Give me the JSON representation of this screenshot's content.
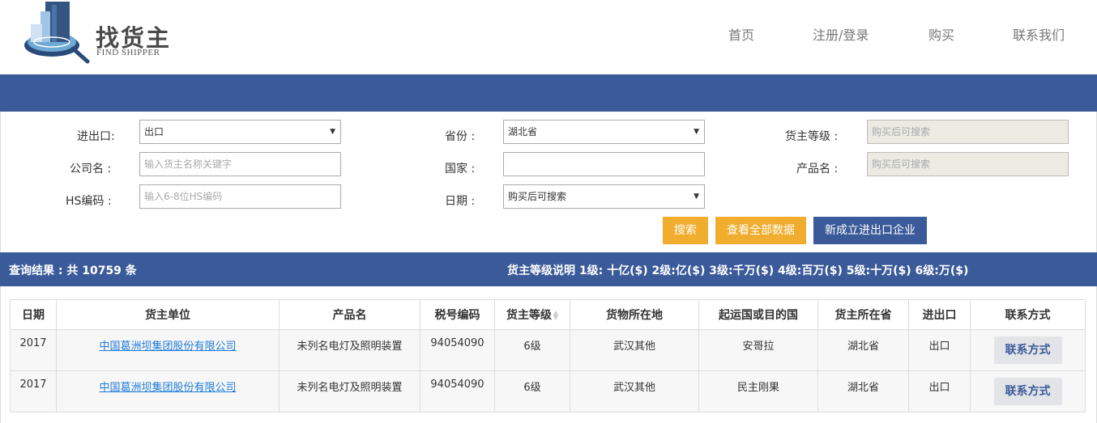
{
  "header": {
    "logo_title": "找货主",
    "logo_sub": "FIND SHIPPER",
    "nav": [
      "首页",
      "注册/登录",
      "购买",
      "联系我们"
    ]
  },
  "form": {
    "row1": {
      "label_a": "进出口:",
      "value_a": "出口",
      "label_b": "省份 :",
      "value_b": "湖北省",
      "label_c": "货主等级 :",
      "placeholder_c": "购买后可搜索"
    },
    "row2": {
      "label_a": "公司名 :",
      "placeholder_a": "输入货主名称关键字",
      "label_b": "国家 :",
      "value_b": "",
      "label_c": "产品名 :",
      "placeholder_c": "购买后可搜索"
    },
    "row3": {
      "label_a": "HS编码 :",
      "placeholder_a": "输入6-8位HS编码",
      "label_b": "日期 :",
      "value_b": "购买后可搜索"
    },
    "buttons": {
      "search": "搜索",
      "view_all": "查看全部数据",
      "new_company": "新成立进出口企业"
    }
  },
  "result": {
    "count_text": "查询结果 : 共 10759 条",
    "grade_legend": "货主等级说明 1级: 十亿($) 2级:亿($) 3级:千万($) 4级:百万($) 5级:十万($) 6级:万($)"
  },
  "table": {
    "headers": [
      "日期",
      "货主单位",
      "产品名",
      "税号编码",
      "货主等级",
      "货物所在地",
      "起运国或目的国",
      "货主所在省",
      "进出口",
      "联系方式"
    ],
    "rows": [
      {
        "date": "2017",
        "company": "中国葛洲坝集团股份有限公司",
        "product": "未列名电灯及照明装置",
        "hs": "94054090",
        "grade": "6级",
        "location": "武汉其他",
        "country": "安哥拉",
        "province": "湖北省",
        "io": "出口",
        "contact": "联系方式"
      },
      {
        "date": "2017",
        "company": "中国葛洲坝集团股份有限公司",
        "product": "未列名电灯及照明装置",
        "hs": "94054090",
        "grade": "6级",
        "location": "武汉其他",
        "country": "民主刚果",
        "province": "湖北省",
        "io": "出口",
        "contact": "联系方式"
      }
    ]
  },
  "colors": {
    "brand_blue": "#3b5a9a",
    "button_orange": "#f0ad2e",
    "link_blue": "#1e7bd8"
  }
}
